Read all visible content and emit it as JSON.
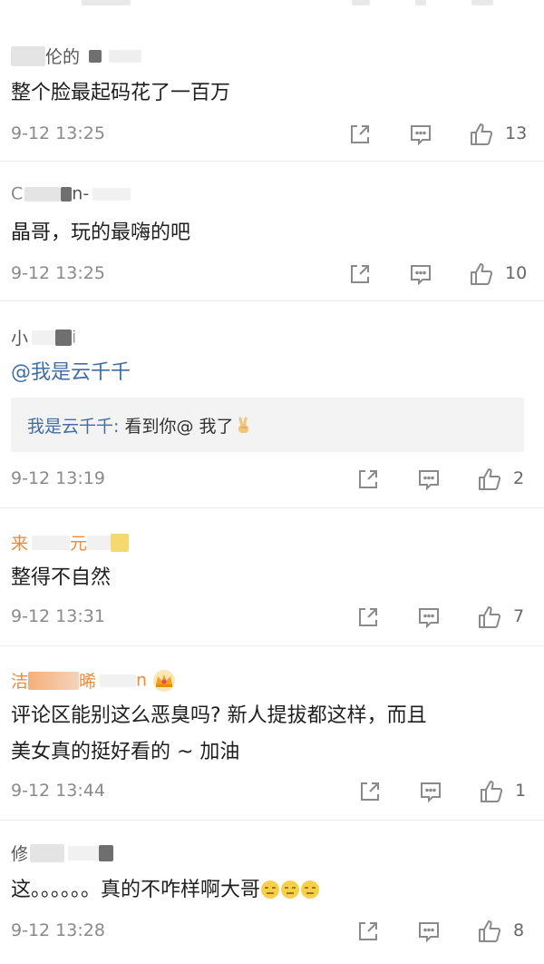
{
  "comments": [
    {
      "username": "伦的",
      "text": "整个脸最起码花了一百万",
      "time": "9-12 13:25",
      "likes": "13"
    },
    {
      "username": "n-",
      "text": "晶哥，玩的最嗨的吧",
      "time": "9-12 13:25",
      "likes": "10"
    },
    {
      "username": "小",
      "text": "@我是云千千",
      "reply_name": "我是云千千:",
      "reply_text": " 看到你@ 我了",
      "time": "9-12 13:19",
      "likes": "2"
    },
    {
      "username": "来",
      "username_tail": "元",
      "text": "整得不自然",
      "time": "9-12 13:31",
      "likes": "7"
    },
    {
      "username": "洁",
      "username_tail": "晞",
      "username_end": "n",
      "text_line1": "评论区能别这么恶臭吗? 新人提拔都这样，而且",
      "text_line2": "美女真的挺好看的 ~ 加油",
      "time": "9-12 13:44",
      "likes": "1"
    },
    {
      "username": "修",
      "text": "这。。。。。。真的不咋样啊大哥",
      "time": "9-12 13:28",
      "likes": "8"
    }
  ],
  "icons": {
    "share": "share-icon",
    "comment": "comment-icon",
    "like": "thumbs-up-icon",
    "emoji_victory": "victory-hand-icon",
    "emoji_face": "expressionless-face-icon",
    "crown": "crown-badge-icon"
  },
  "colors": {
    "link": "#3f6ea8",
    "timestamp": "#8a8a8a",
    "reply_bg": "#f3f3f3",
    "icon": "#8a8a8a",
    "vip_name": "#f08a3c"
  }
}
